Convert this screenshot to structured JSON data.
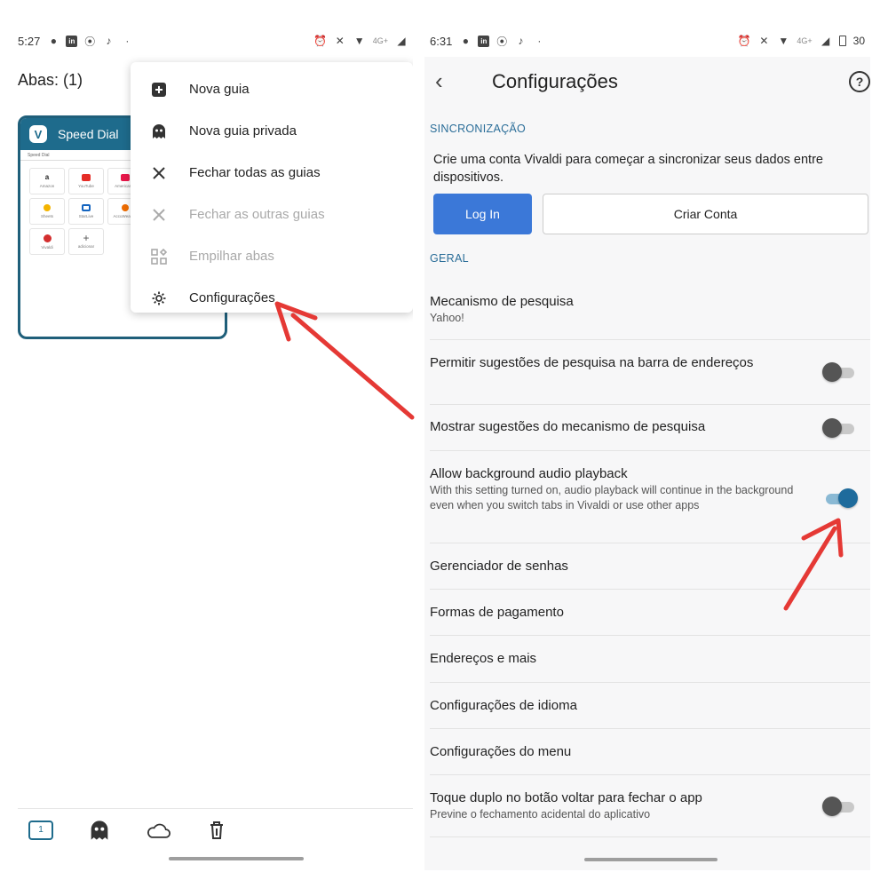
{
  "left": {
    "status": {
      "time": "5:27",
      "net": "4G+"
    },
    "tabs_title": "Abas: (1)",
    "tab_card": {
      "title": "Speed Dial",
      "tab_label": "Speed Dial",
      "tiles": [
        "Amazon",
        "YouTube",
        "Americanas",
        "Sheets",
        "StarLive",
        "AccuWeather",
        "Vivaldi",
        "adicionar"
      ]
    },
    "menu": [
      {
        "label": "Nova guia",
        "icon": "plus-box-icon",
        "disabled": false
      },
      {
        "label": "Nova guia privada",
        "icon": "ghost-icon",
        "disabled": false
      },
      {
        "label": "Fechar todas as guias",
        "icon": "close-icon",
        "disabled": false
      },
      {
        "label": "Fechar as outras guias",
        "icon": "close-icon",
        "disabled": true
      },
      {
        "label": "Empilhar abas",
        "icon": "stack-icon",
        "disabled": true
      },
      {
        "label": "Configurações",
        "icon": "gear-icon",
        "disabled": false
      }
    ],
    "bottom": {
      "tab_count": "1"
    }
  },
  "right": {
    "status": {
      "time": "6:31",
      "net": "4G+",
      "battery": "30"
    },
    "title": "Configurações",
    "sync_header": "SINCRONIZAÇÃO",
    "sync_text": "Crie uma conta Vivaldi para começar a sincronizar seus dados entre dispositivos.",
    "login_label": "Log In",
    "create_label": "Criar Conta",
    "general_header": "GERAL",
    "items": [
      {
        "label": "Mecanismo de pesquisa",
        "sub": "Yahoo!",
        "toggle": null
      },
      {
        "label": "Permitir sugestões de pesquisa na barra de endereços",
        "sub": "",
        "toggle": "off"
      },
      {
        "label": "Mostrar sugestões do mecanismo de pesquisa",
        "sub": "",
        "toggle": "off"
      },
      {
        "label": "Allow background audio playback",
        "sub": "With this setting turned on, audio playback will continue in the background even when you switch tabs in Vivaldi or use other apps",
        "toggle": "on"
      },
      {
        "label": "Gerenciador de senhas",
        "sub": "",
        "toggle": null
      },
      {
        "label": "Formas de pagamento",
        "sub": "",
        "toggle": null
      },
      {
        "label": "Endereços e mais",
        "sub": "",
        "toggle": null
      },
      {
        "label": "Configurações de idioma",
        "sub": "",
        "toggle": null
      },
      {
        "label": "Configurações do menu",
        "sub": "",
        "toggle": null
      },
      {
        "label": "Toque duplo no botão voltar para fechar o app",
        "sub": "Previne o fechamento acidental do aplicativo",
        "toggle": "off"
      }
    ]
  },
  "colors": {
    "accent": "#1e6b8c",
    "login": "#3b78d8",
    "arrow": "#e53935",
    "section": "#2a6d98"
  }
}
